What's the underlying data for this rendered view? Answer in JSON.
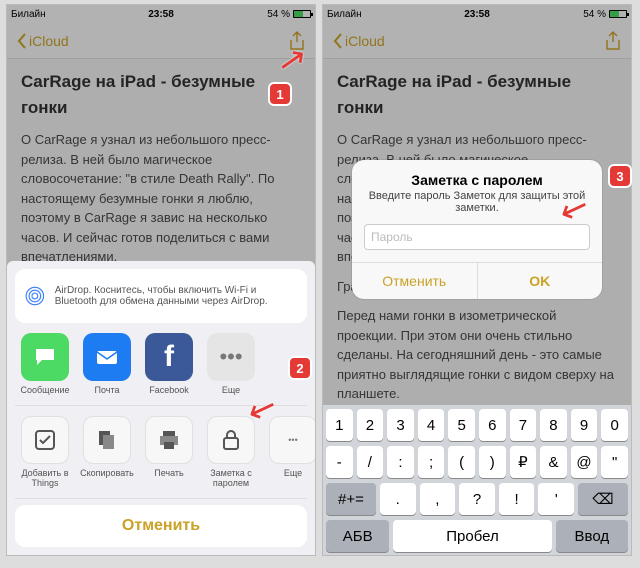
{
  "status": {
    "carrier": "Билайн",
    "time": "23:58",
    "battery": "54 %"
  },
  "nav": {
    "back": "iCloud"
  },
  "note": {
    "title": "CarRage на iPad - безумные гонки",
    "body": "О CarRage я узнал из небольшого пресс-релиза. В ней было магическое словосочетание: \"в стиле Death Rally\". По настоящему безумные гонки я люблю, поэтому в CarRage я завис на несколько часов. И сейчас готов поделиться с вами впечатлениями.",
    "body2a": "Графи",
    "body2": "Перед нами гонки в изометрической проекции. При этом они очень стильно сделаны. На сегодняшний день - это самые приятно выглядящие гонки с видом сверху на планшете."
  },
  "sheet": {
    "airdrop": "AirDrop. Коснитесь, чтобы включить Wi-Fi и Bluetooth для обмена данными через AirDrop.",
    "apps": [
      "Сообщение",
      "Почта",
      "Facebook",
      "Еще"
    ],
    "actions": [
      "Добавить в Things",
      "Скопировать",
      "Печать",
      "Заметка с паролем",
      "Еще"
    ],
    "cancel": "Отменить"
  },
  "alert": {
    "title": "Заметка с паролем",
    "msg": "Введите пароль Заметок для защиты этой заметки.",
    "placeholder": "Пароль",
    "cancel": "Отменить",
    "ok": "OK"
  },
  "kb": {
    "r1": [
      "1",
      "2",
      "3",
      "4",
      "5",
      "6",
      "7",
      "8",
      "9",
      "0"
    ],
    "r2": [
      "-",
      "/",
      ":",
      ";",
      "(",
      ")",
      "₽",
      "&",
      "@",
      "\""
    ],
    "r3": [
      "#+=",
      ".",
      ",",
      "?",
      "!",
      "'",
      "⌫"
    ],
    "r4": [
      "АБВ",
      "Пробел",
      "Ввод"
    ]
  },
  "callouts": {
    "c1": "1",
    "c2": "2",
    "c3": "3"
  }
}
